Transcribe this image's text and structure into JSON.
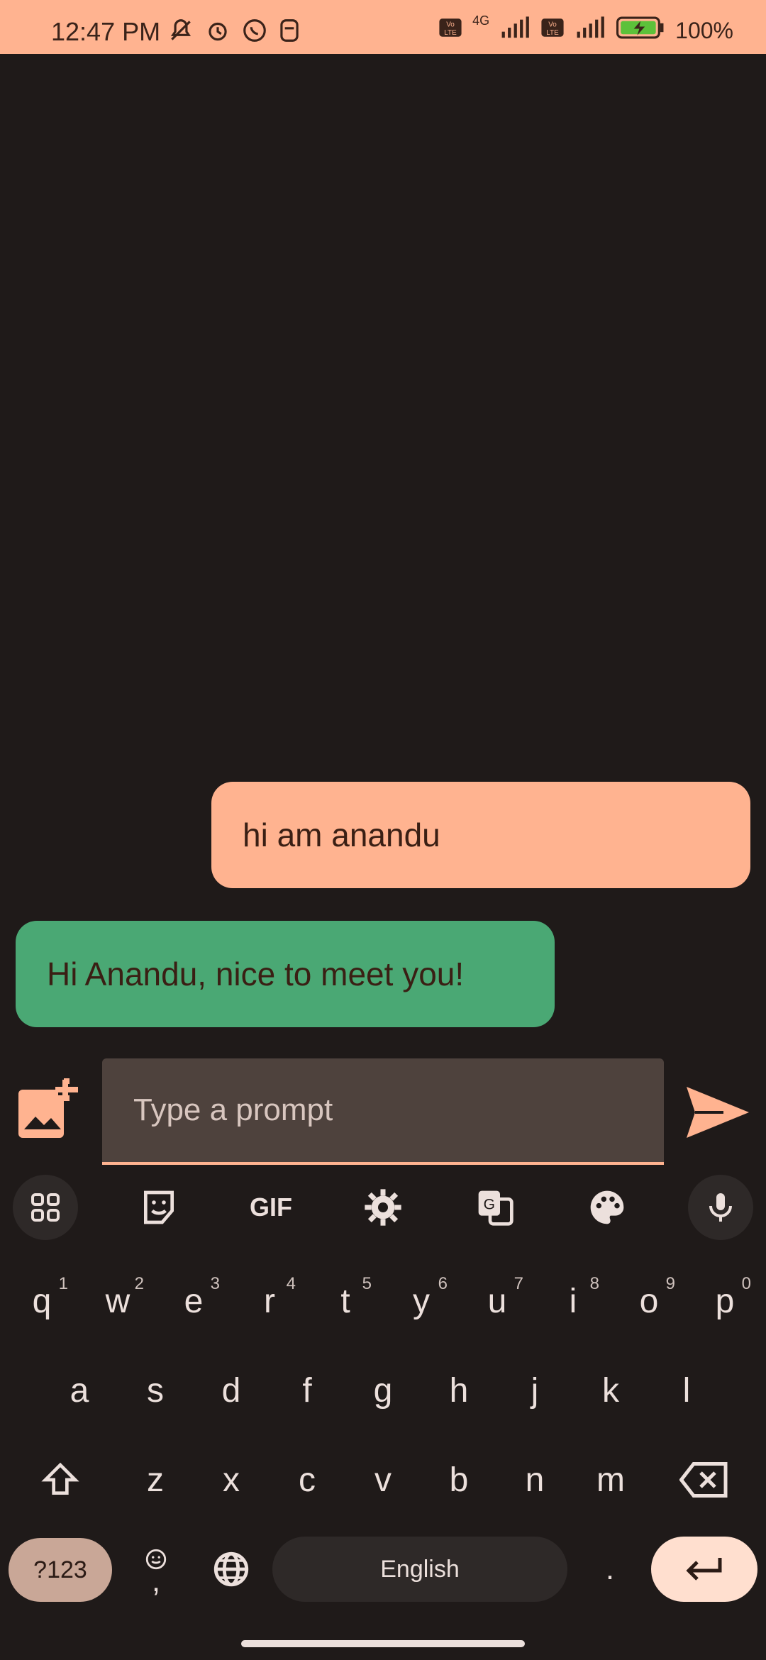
{
  "status_bar": {
    "time": "12:47 PM",
    "network_label": "4G",
    "volte_label": "Vo LTE",
    "battery_percent": "100%"
  },
  "chat": {
    "messages": [
      {
        "role": "user",
        "text": "hi am anandu"
      },
      {
        "role": "bot",
        "text": "Hi Anandu, nice to meet you!"
      }
    ]
  },
  "input": {
    "placeholder": "Type a prompt"
  },
  "keyboard": {
    "toolbar_gif": "GIF",
    "row1": [
      "q",
      "w",
      "e",
      "r",
      "t",
      "y",
      "u",
      "i",
      "o",
      "p"
    ],
    "row1_hints": [
      "1",
      "2",
      "3",
      "4",
      "5",
      "6",
      "7",
      "8",
      "9",
      "0"
    ],
    "row2": [
      "a",
      "s",
      "d",
      "f",
      "g",
      "h",
      "j",
      "k",
      "l"
    ],
    "row3": [
      "z",
      "x",
      "c",
      "v",
      "b",
      "n",
      "m"
    ],
    "symbols_label": "?123",
    "comma_label": ",",
    "space_label": "English",
    "period_label": "."
  },
  "colors": {
    "accent": "#ffb390",
    "bot_bubble": "#4aa874",
    "background": "#1f1a19"
  }
}
